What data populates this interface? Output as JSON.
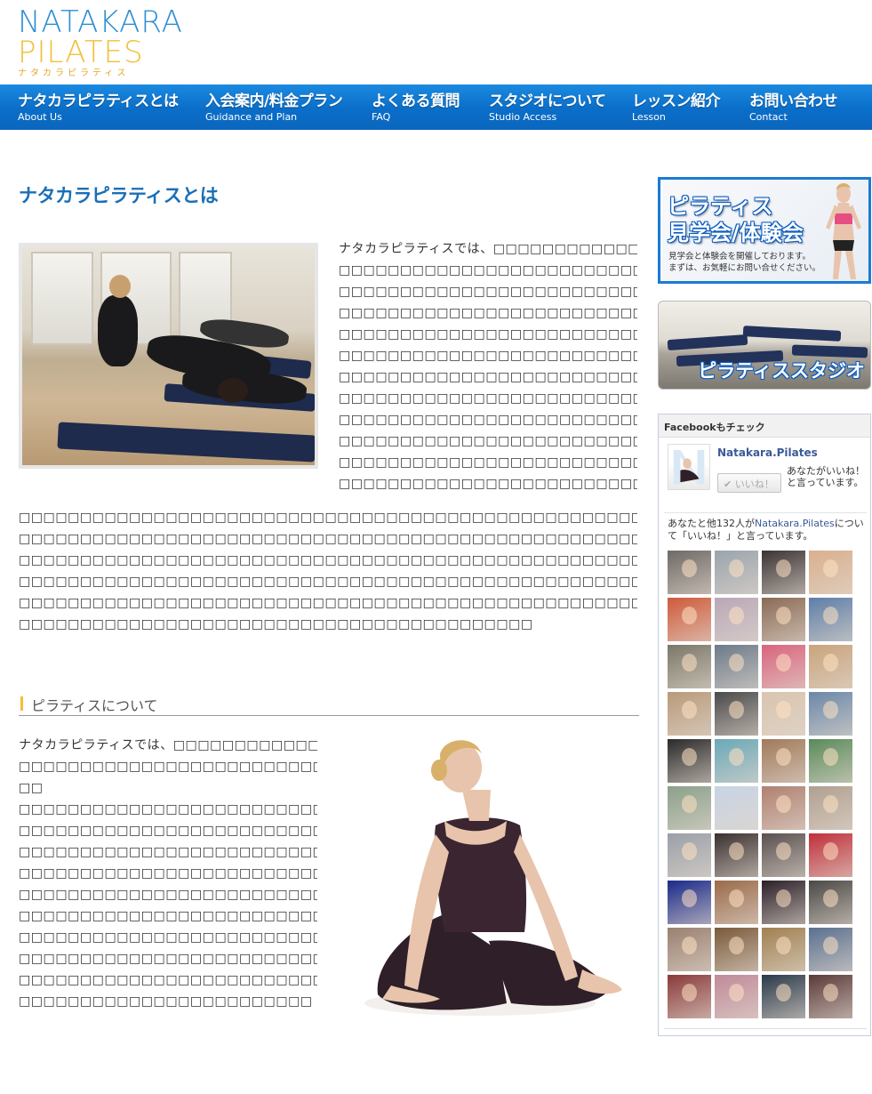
{
  "logo": {
    "line1": "NATAKARA",
    "line2": "PILATES",
    "kana": "ナタカラピラティス"
  },
  "nav": [
    {
      "jp": "ナタカラピラティスとは",
      "en": "About Us"
    },
    {
      "jp": "入会案内/料金プラン",
      "en": "Guidance and Plan"
    },
    {
      "jp": "よくある質問",
      "en": "FAQ"
    },
    {
      "jp": "スタジオについて",
      "en": "Studio Access"
    },
    {
      "jp": "レッスン紹介",
      "en": "Lesson"
    },
    {
      "jp": "お問い合わせ",
      "en": "Contact"
    }
  ],
  "main": {
    "title": "ナタカラピラティスとは",
    "intro_lines": [
      "ナタカラピラティスでは、□□□□□□□□□□□□□□□□□",
      "□□□□□□□□□□□□□□□□□□□□□□□□□□",
      "□□□□□□□□□□□□□□□□□□□□□□□□□□",
      "□□□□□□□□□□□□□□□□□□□□□□□□□□",
      "□□□□□□□□□□□□□□□□□□□□□□□□□□",
      "□□□□□□□□□□□□□□□□□□□□□□□□□□",
      "□□□□□□□□□□□□□□□□□□□□□□□□□□",
      "□□□□□□□□□□□□□□□□□□□□□□□□□□",
      "□□□□□□□□□□□□□□□□□□□□□□□□□□",
      "□□□□□□□□□□□□□□□□□□□□□□□□□□",
      "□□□□□□□□□□□□□□□□□□□□□□□□□□",
      "□□□□□□□□□□□□□□□□□□□□□□□□□□"
    ],
    "full_lines": [
      "□□□□□□□□□□□□□□□□□□□□□□□□□□□□□□□□□□□□□□□□□□□□□□□□□□□□□□",
      "□□□□□□□□□□□□□□□□□□□□□□□□□□□□□□□□□□□□□□□□□□□□□□□□□□□□□□",
      "□□□□□□□□□□□□□□□□□□□□□□□□□□□□□□□□□□□□□□□□□□□□□□□□□□□□□□",
      "□□□□□□□□□□□□□□□□□□□□□□□□□□□□□□□□□□□□□□□□□□□□□□□□□□□□□□",
      "□□□□□□□□□□□□□□□□□□□□□□□□□□□□□□□□□□□□□□□□□□□□□□□□□□□□□□",
      "□□□□□□□□□□□□□□□□□□□□□□□□□□□□□□□□□□□□□□□□□□"
    ],
    "section_heading": "ピラティスについて",
    "section_lines": [
      "ナタカラピラティスでは、□□□□□□□□□□□□□□□□□",
      "□□□□□□□□□□□□□□□□□□□□□□□□□□",
      "□□",
      "□□□□□□□□□□□□□□□□□□□□□□□□□□",
      "□□□□□□□□□□□□□□□□□□□□□□□□□□",
      "□□□□□□□□□□□□□□□□□□□□□□□□□□",
      "□□□□□□□□□□□□□□□□□□□□□□□□□□",
      "□□□□□□□□□□□□□□□□□□□□□□□□□□",
      "□□□□□□□□□□□□□□□□□□□□□□□□□□",
      "□□□□□□□□□□□□□□□□□□□□□□□□□□",
      "□□□□□□□□□□□□□□□□□□□□□□□□□□",
      "□□□□□□□□□□□□□□□□□□□□□□□□□□",
      "□□□□□□□□□□□□□□□□□□□□□□□□"
    ]
  },
  "sidebar": {
    "banner1": {
      "line1": "ピラティス",
      "line2": "見学会/体験会",
      "sub1": "見学会と体験会を開催しております。",
      "sub2": "まずは、お気軽にお問い合せください。"
    },
    "banner2": {
      "text": "ピラティススタジオ"
    },
    "facebook": {
      "header": "Facebookもチェック",
      "page_name": "Natakara.Pilates",
      "like_button": "✔ いいね！",
      "like_note": "あなたがいいね！と言っています。",
      "count_prefix": "あなたと他132人が",
      "count_link": "Natakara.Pilates",
      "count_suffix": "について「いいね！」と言っています。",
      "faces": [
        "#6f6a66",
        "#9aa4ad",
        "#3a3434",
        "#d9b08e",
        "#cf5a3b",
        "#b8a8b8",
        "#8a6a55",
        "#5e7ea8",
        "#7a7868",
        "#6c7a8a",
        "#d9647e",
        "#c9a47c",
        "#b89a7a",
        "#4a4a4a",
        "#d9c5b0",
        "#6a88a8",
        "#2a2a2a",
        "#6aa8b8",
        "#a07a5a",
        "#5a8a5a",
        "#8aa08a",
        "#c8d4e4",
        "#b08070",
        "#b0a090",
        "#9aa0a8",
        "#3a3030",
        "#5a5050",
        "#c0303a",
        "#1a2a8a",
        "#9a6a4a",
        "#2a2028",
        "#4a4846",
        "#9a8070",
        "#7a5a3a",
        "#a08050",
        "#5a7090",
        "#8a3a3a",
        "#c08a9a",
        "#2a3a4a",
        "#5a3a3a"
      ]
    }
  }
}
